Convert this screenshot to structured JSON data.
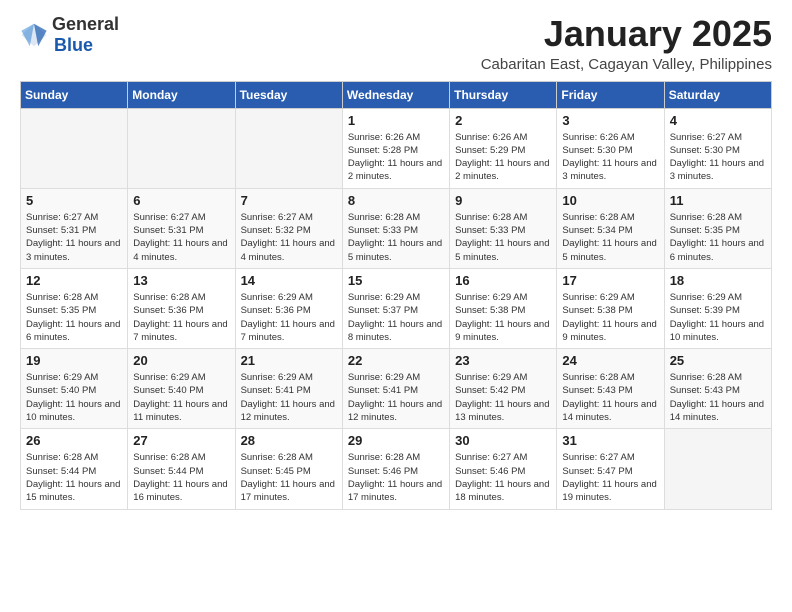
{
  "header": {
    "logo_general": "General",
    "logo_blue": "Blue",
    "month_title": "January 2025",
    "location": "Cabaritan East, Cagayan Valley, Philippines"
  },
  "days_of_week": [
    "Sunday",
    "Monday",
    "Tuesday",
    "Wednesday",
    "Thursday",
    "Friday",
    "Saturday"
  ],
  "weeks": [
    [
      {
        "num": "",
        "text": ""
      },
      {
        "num": "",
        "text": ""
      },
      {
        "num": "",
        "text": ""
      },
      {
        "num": "1",
        "text": "Sunrise: 6:26 AM\nSunset: 5:28 PM\nDaylight: 11 hours and 2 minutes."
      },
      {
        "num": "2",
        "text": "Sunrise: 6:26 AM\nSunset: 5:29 PM\nDaylight: 11 hours and 2 minutes."
      },
      {
        "num": "3",
        "text": "Sunrise: 6:26 AM\nSunset: 5:30 PM\nDaylight: 11 hours and 3 minutes."
      },
      {
        "num": "4",
        "text": "Sunrise: 6:27 AM\nSunset: 5:30 PM\nDaylight: 11 hours and 3 minutes."
      }
    ],
    [
      {
        "num": "5",
        "text": "Sunrise: 6:27 AM\nSunset: 5:31 PM\nDaylight: 11 hours and 3 minutes."
      },
      {
        "num": "6",
        "text": "Sunrise: 6:27 AM\nSunset: 5:31 PM\nDaylight: 11 hours and 4 minutes."
      },
      {
        "num": "7",
        "text": "Sunrise: 6:27 AM\nSunset: 5:32 PM\nDaylight: 11 hours and 4 minutes."
      },
      {
        "num": "8",
        "text": "Sunrise: 6:28 AM\nSunset: 5:33 PM\nDaylight: 11 hours and 5 minutes."
      },
      {
        "num": "9",
        "text": "Sunrise: 6:28 AM\nSunset: 5:33 PM\nDaylight: 11 hours and 5 minutes."
      },
      {
        "num": "10",
        "text": "Sunrise: 6:28 AM\nSunset: 5:34 PM\nDaylight: 11 hours and 5 minutes."
      },
      {
        "num": "11",
        "text": "Sunrise: 6:28 AM\nSunset: 5:35 PM\nDaylight: 11 hours and 6 minutes."
      }
    ],
    [
      {
        "num": "12",
        "text": "Sunrise: 6:28 AM\nSunset: 5:35 PM\nDaylight: 11 hours and 6 minutes."
      },
      {
        "num": "13",
        "text": "Sunrise: 6:28 AM\nSunset: 5:36 PM\nDaylight: 11 hours and 7 minutes."
      },
      {
        "num": "14",
        "text": "Sunrise: 6:29 AM\nSunset: 5:36 PM\nDaylight: 11 hours and 7 minutes."
      },
      {
        "num": "15",
        "text": "Sunrise: 6:29 AM\nSunset: 5:37 PM\nDaylight: 11 hours and 8 minutes."
      },
      {
        "num": "16",
        "text": "Sunrise: 6:29 AM\nSunset: 5:38 PM\nDaylight: 11 hours and 9 minutes."
      },
      {
        "num": "17",
        "text": "Sunrise: 6:29 AM\nSunset: 5:38 PM\nDaylight: 11 hours and 9 minutes."
      },
      {
        "num": "18",
        "text": "Sunrise: 6:29 AM\nSunset: 5:39 PM\nDaylight: 11 hours and 10 minutes."
      }
    ],
    [
      {
        "num": "19",
        "text": "Sunrise: 6:29 AM\nSunset: 5:40 PM\nDaylight: 11 hours and 10 minutes."
      },
      {
        "num": "20",
        "text": "Sunrise: 6:29 AM\nSunset: 5:40 PM\nDaylight: 11 hours and 11 minutes."
      },
      {
        "num": "21",
        "text": "Sunrise: 6:29 AM\nSunset: 5:41 PM\nDaylight: 11 hours and 12 minutes."
      },
      {
        "num": "22",
        "text": "Sunrise: 6:29 AM\nSunset: 5:41 PM\nDaylight: 11 hours and 12 minutes."
      },
      {
        "num": "23",
        "text": "Sunrise: 6:29 AM\nSunset: 5:42 PM\nDaylight: 11 hours and 13 minutes."
      },
      {
        "num": "24",
        "text": "Sunrise: 6:28 AM\nSunset: 5:43 PM\nDaylight: 11 hours and 14 minutes."
      },
      {
        "num": "25",
        "text": "Sunrise: 6:28 AM\nSunset: 5:43 PM\nDaylight: 11 hours and 14 minutes."
      }
    ],
    [
      {
        "num": "26",
        "text": "Sunrise: 6:28 AM\nSunset: 5:44 PM\nDaylight: 11 hours and 15 minutes."
      },
      {
        "num": "27",
        "text": "Sunrise: 6:28 AM\nSunset: 5:44 PM\nDaylight: 11 hours and 16 minutes."
      },
      {
        "num": "28",
        "text": "Sunrise: 6:28 AM\nSunset: 5:45 PM\nDaylight: 11 hours and 17 minutes."
      },
      {
        "num": "29",
        "text": "Sunrise: 6:28 AM\nSunset: 5:46 PM\nDaylight: 11 hours and 17 minutes."
      },
      {
        "num": "30",
        "text": "Sunrise: 6:27 AM\nSunset: 5:46 PM\nDaylight: 11 hours and 18 minutes."
      },
      {
        "num": "31",
        "text": "Sunrise: 6:27 AM\nSunset: 5:47 PM\nDaylight: 11 hours and 19 minutes."
      },
      {
        "num": "",
        "text": ""
      }
    ]
  ]
}
